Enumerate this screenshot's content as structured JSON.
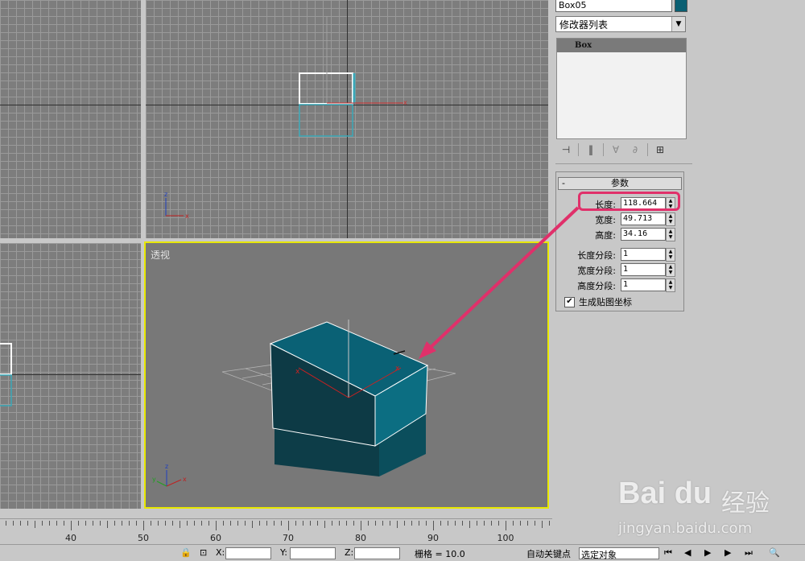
{
  "object_name": "Box05",
  "object_color": "#0a5f72",
  "modifier_list_label": "修改器列表",
  "modifier_stack": [
    "Box"
  ],
  "stack_tool_icons": [
    "pin-stack-icon",
    "show-end-result-icon",
    "make-unique-icon",
    "remove-modifier-icon",
    "configure-modifier-sets-icon"
  ],
  "rollout": {
    "title": "参数",
    "collapse_symbol": "-",
    "params": [
      {
        "label": "长度:",
        "value": "118.664"
      },
      {
        "label": "宽度:",
        "value": "49.713"
      },
      {
        "label": "高度:",
        "value": "34.16"
      },
      {
        "label": "长度分段:",
        "value": "1"
      },
      {
        "label": "宽度分段:",
        "value": "1"
      },
      {
        "label": "高度分段:",
        "value": "1"
      }
    ],
    "gen_map_coords": {
      "label": "生成贴图坐标",
      "checked": true,
      "mark": "✔"
    }
  },
  "viewports": {
    "perspective_label": "透视",
    "active_border_color": "#e8e800"
  },
  "timeline": {
    "ticks": [
      "40",
      "50",
      "60",
      "70",
      "80",
      "90",
      "100"
    ]
  },
  "status": {
    "x_label": "X:",
    "y_label": "Y:",
    "z_label": "Z:",
    "grid_text": "栅格 = 10.0",
    "autokey_label": "自动关键点",
    "selected_dropdown": "选定对象"
  },
  "annotation": {
    "highlight_color": "#e0306a"
  },
  "watermark": {
    "brand": "Bai du",
    "cn": "经验",
    "url": "jingyan.baidu.com"
  }
}
